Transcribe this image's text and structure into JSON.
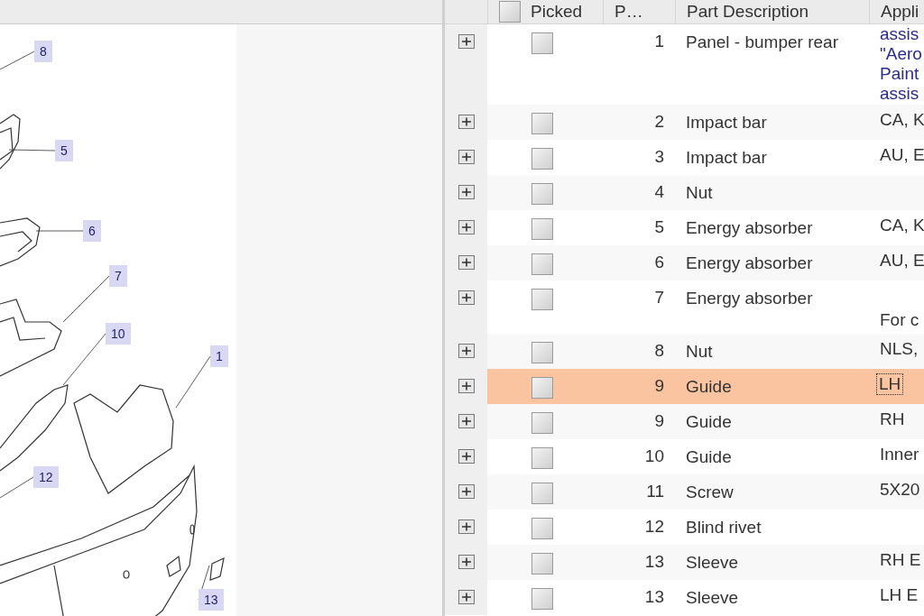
{
  "diagram": {
    "callouts": [
      {
        "label": "8"
      },
      {
        "label": "5"
      },
      {
        "label": "6"
      },
      {
        "label": "7"
      },
      {
        "label": "10"
      },
      {
        "label": "1"
      },
      {
        "label": "12"
      },
      {
        "label": "13"
      }
    ]
  },
  "table": {
    "header_checked": false,
    "columns": [
      "Picked",
      "P…",
      "Part Description",
      "Appli"
    ],
    "rows": [
      {
        "number": "1",
        "description": "Panel - bumper rear",
        "application": [
          "assis",
          "\"Aero",
          "Paint",
          "assis"
        ],
        "checked": false,
        "selected": false
      },
      {
        "number": "2",
        "description": "Impact bar",
        "application": [
          "CA, K"
        ],
        "checked": false,
        "selected": false
      },
      {
        "number": "3",
        "description": "Impact bar",
        "application": [
          "AU, E"
        ],
        "checked": false,
        "selected": false
      },
      {
        "number": "4",
        "description": "Nut",
        "checked": false,
        "selected": false
      },
      {
        "number": "5",
        "description": "Energy absorber",
        "application": [
          "CA, K"
        ],
        "checked": false,
        "selected": false
      },
      {
        "number": "6",
        "description": "Energy absorber",
        "application": [
          "AU, E"
        ],
        "checked": false,
        "selected": false
      },
      {
        "number": "7",
        "description": "Energy absorber",
        "application": [
          "For c"
        ],
        "checked": false,
        "selected": false
      },
      {
        "number": "8",
        "description": "Nut",
        "application": [
          "NLS,"
        ],
        "checked": false,
        "selected": false
      },
      {
        "number": "9",
        "description": "Guide",
        "application": [
          "LH"
        ],
        "checked": false,
        "selected": true
      },
      {
        "number": "9",
        "description": "Guide",
        "application": [
          "RH"
        ],
        "checked": false,
        "selected": false
      },
      {
        "number": "10",
        "description": "Guide",
        "application": [
          "Inner"
        ],
        "checked": false,
        "selected": false
      },
      {
        "number": "11",
        "description": "Screw",
        "application": [
          "5X20"
        ],
        "checked": false,
        "selected": false
      },
      {
        "number": "12",
        "description": "Blind rivet",
        "checked": false,
        "selected": false
      },
      {
        "number": "13",
        "description": "Sleeve",
        "application": [
          "RH E"
        ],
        "checked": false,
        "selected": false
      },
      {
        "number": "13",
        "description": "Sleeve",
        "application": [
          "LH E"
        ],
        "checked": false,
        "selected": false
      }
    ]
  }
}
